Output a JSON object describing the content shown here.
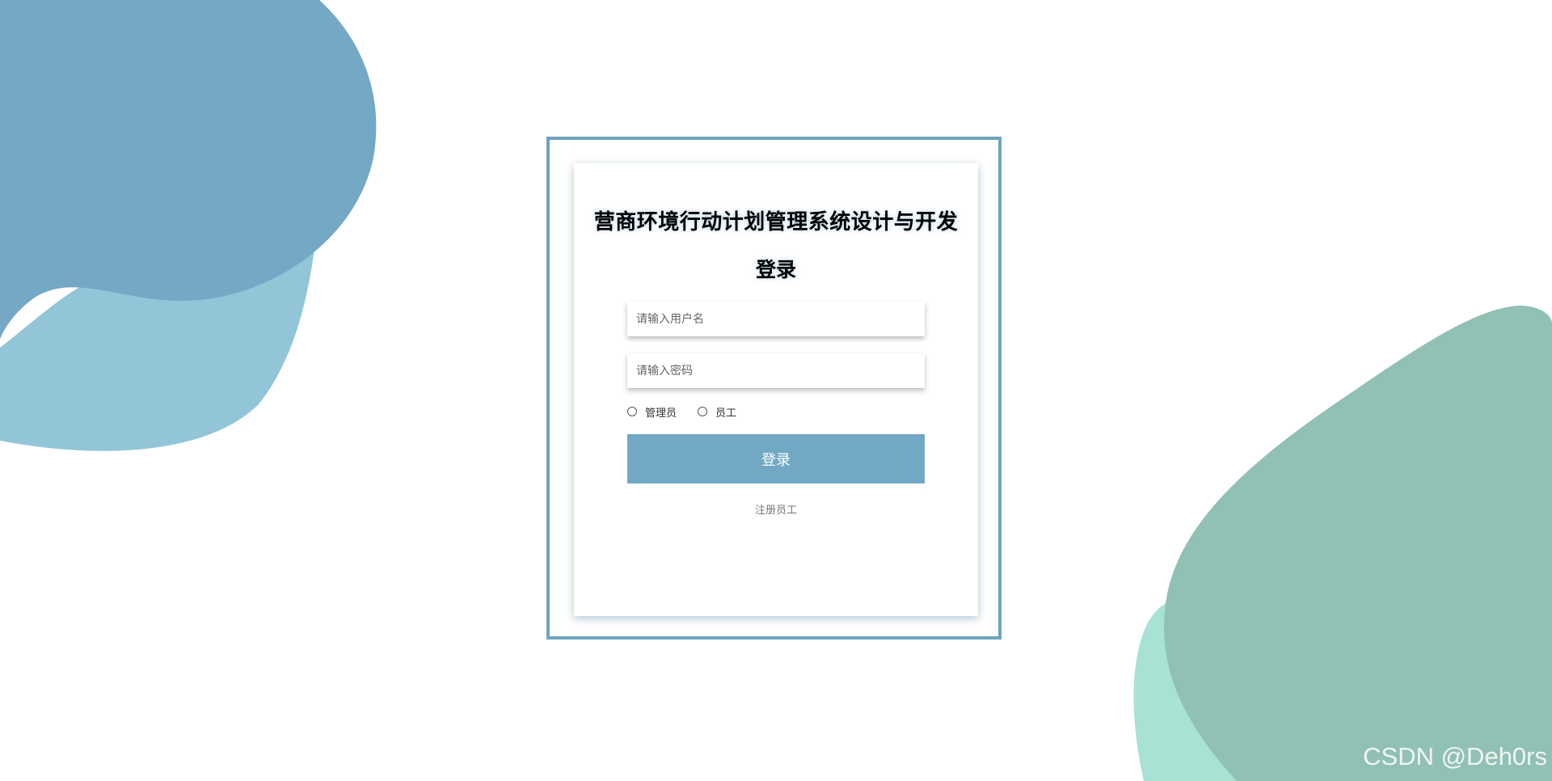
{
  "app": {
    "title": "营商环境行动计划管理系统设计与开发",
    "subtitle": "登录"
  },
  "form": {
    "username_placeholder": "请输入用户名",
    "password_placeholder": "请输入密码",
    "roles": [
      {
        "label": "管理员",
        "selected": false
      },
      {
        "label": "员工",
        "selected": false
      }
    ],
    "login_label": "登录",
    "register_label": "注册员工"
  },
  "watermark": "CSDN @Deh0rs",
  "colors": {
    "accent": "#72a8c3",
    "frame": "#6fa3bd",
    "blob_blue_dark": "#74a8c5",
    "blob_blue_light": "#92c5d8",
    "blob_green_dark": "#91c1b4",
    "blob_green_light": "#a7e2d5"
  }
}
